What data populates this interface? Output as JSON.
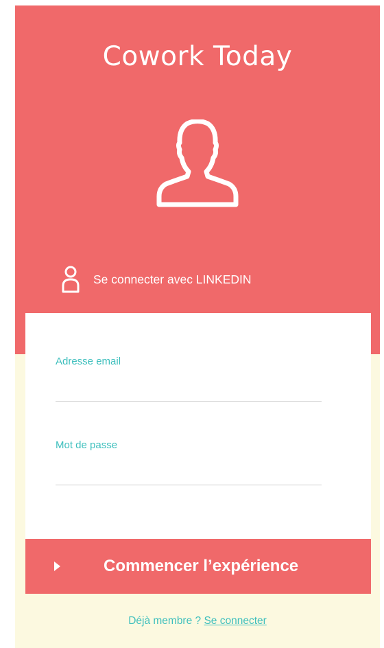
{
  "app": {
    "title": "Cowork Today"
  },
  "hero": {
    "avatar_icon": "user-silhouette-icon",
    "linkedin_icon": "user-icon",
    "linkedin_label": "Se connecter avec LINKEDIN"
  },
  "form": {
    "email_label": "Adresse email",
    "email_value": "",
    "email_placeholder": "",
    "password_label": "Mot de passe",
    "password_value": "",
    "password_placeholder": "",
    "submit_icon": "play-arrow-icon",
    "submit_label": "Commencer l’expérience"
  },
  "footer": {
    "prompt": "Déjà membre ? ",
    "link_label": "Se connecter"
  },
  "colors": {
    "brand_coral": "#f0696a",
    "accent_teal": "#3dbfbd",
    "background_cream": "#fcf9e0",
    "card_white": "#ffffff"
  }
}
